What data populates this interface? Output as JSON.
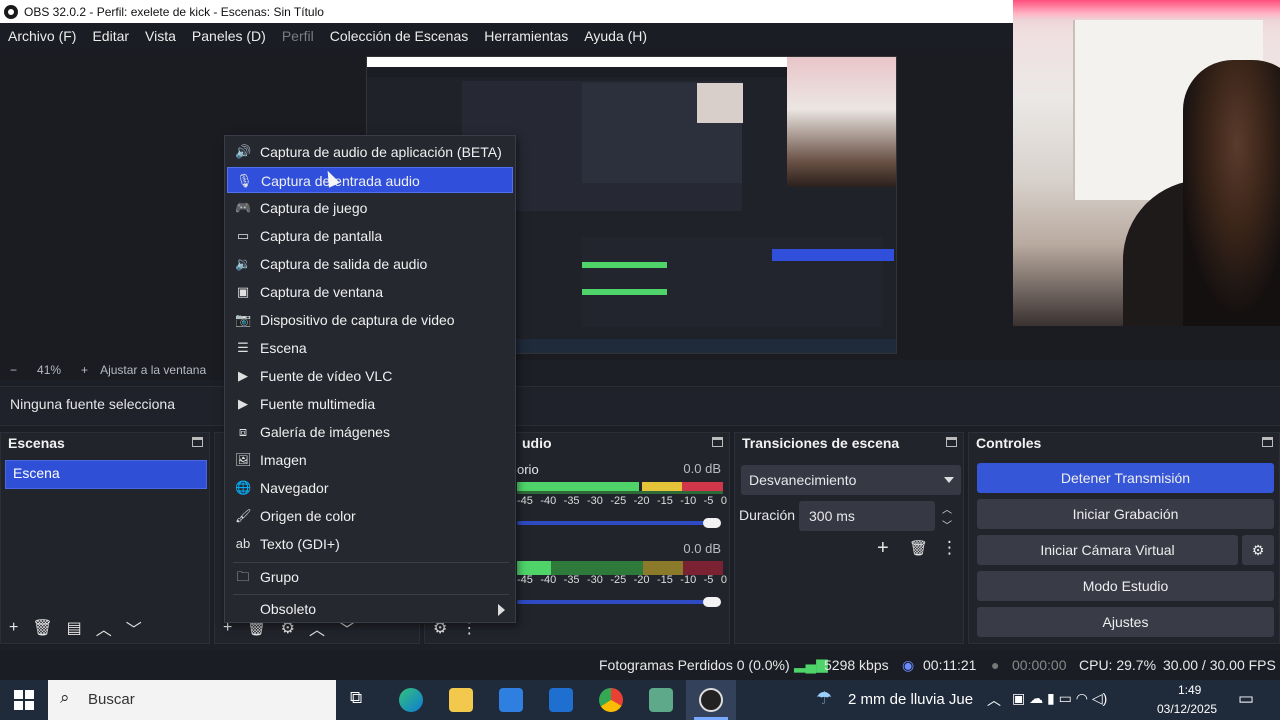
{
  "window": {
    "title": "OBS 32.0.2 - Perfil: exelete de kick - Escenas: Sin Título"
  },
  "menu": [
    {
      "label": "Archivo (F)",
      "enabled": true
    },
    {
      "label": "Editar",
      "enabled": true
    },
    {
      "label": "Vista",
      "enabled": true
    },
    {
      "label": "Paneles (D)",
      "enabled": true
    },
    {
      "label": "Perfil",
      "enabled": false
    },
    {
      "label": "Colección de Escenas",
      "enabled": true
    },
    {
      "label": "Herramientas",
      "enabled": true
    },
    {
      "label": "Ayuda (H)",
      "enabled": true
    }
  ],
  "zoom": {
    "minus": "−",
    "value": "41%",
    "plus": "+",
    "fit_label": "Ajustar a la ventana"
  },
  "source_bar": {
    "no_source": "Ninguna fuente selecciona"
  },
  "context_menu": {
    "items": [
      {
        "label": "Captura de audio de aplicación (BETA)",
        "icon": "speaker-app-icon"
      },
      {
        "label": "Captura de entrada audio",
        "icon": "microphone-icon",
        "active": true
      },
      {
        "label": "Captura de juego",
        "icon": "gamepad-icon"
      },
      {
        "label": "Captura de pantalla",
        "icon": "monitor-icon"
      },
      {
        "label": "Captura de salida de audio",
        "icon": "speaker-icon"
      },
      {
        "label": "Captura de ventana",
        "icon": "window-icon"
      },
      {
        "label": "Dispositivo de captura de video",
        "icon": "camera-icon"
      },
      {
        "label": "Escena",
        "icon": "list-icon"
      },
      {
        "label": "Fuente de vídeo VLC",
        "icon": "play-icon"
      },
      {
        "label": "Fuente multimedia",
        "icon": "play-icon"
      },
      {
        "label": "Galería de imágenes",
        "icon": "slideshow-icon"
      },
      {
        "label": "Imagen",
        "icon": "image-icon"
      },
      {
        "label": "Navegador",
        "icon": "globe-icon"
      },
      {
        "label": "Origen de color",
        "icon": "brush-icon"
      },
      {
        "label": "Texto (GDI+)",
        "icon": "text-icon"
      }
    ],
    "group": {
      "label": "Grupo",
      "icon": "folder-icon"
    },
    "obsolete": {
      "label": "Obsoleto",
      "icon": "submenu-arrow-icon"
    }
  },
  "docks": {
    "scenes": {
      "title": "Escenas",
      "items": [
        "Escena"
      ]
    },
    "audio": {
      "title": "udio",
      "channel1": {
        "name": "orio",
        "db": "0.0 dB"
      },
      "channel2": {
        "name": "",
        "db": "0.0 dB"
      },
      "ticks": [
        "-45",
        "-40",
        "-35",
        "-30",
        "-25",
        "-20",
        "-15",
        "-10",
        "-5",
        "0"
      ]
    },
    "transitions": {
      "title": "Transiciones de escena",
      "transition": "Desvanecimiento",
      "duration_label": "Duración",
      "duration": "300 ms"
    },
    "controls": {
      "title": "Controles",
      "buttons": {
        "stream": "Detener Transmisión",
        "record": "Iniciar Grabación",
        "virtual_cam": "Iniciar Cámara Virtual",
        "studio": "Modo Estudio",
        "settings": "Ajustes"
      }
    }
  },
  "status": {
    "dropped": "Fotogramas Perdidos 0 (0.0%)",
    "bitrate": "5298 kbps",
    "stream_time": "00:11:21",
    "rec_time": "00:00:00",
    "cpu": "CPU: 29.7%",
    "fps": "30.00 / 30.00 FPS"
  },
  "taskbar": {
    "search_placeholder": "Buscar",
    "weather": "2 mm de lluvia Jue",
    "time": "1:49",
    "date": "03/12/2025"
  },
  "colors": {
    "accent": "#3050dc",
    "panel": "#22242c",
    "meter_green": "#4fd46a",
    "meter_yellow": "#e6c43a",
    "meter_red": "#d0374b"
  }
}
